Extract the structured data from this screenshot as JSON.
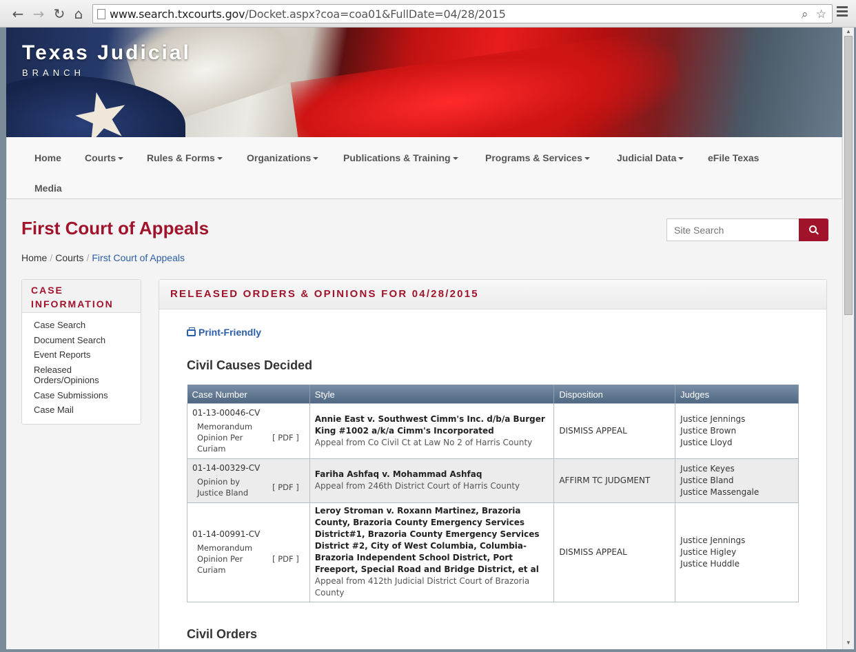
{
  "browser": {
    "url_host": "www.search.txcourts.gov",
    "url_path": "/Docket.aspx?coa=coa01&FullDate=04/28/2015"
  },
  "brand": {
    "title": "Texas Judicial",
    "subtitle": "BRANCH"
  },
  "nav": [
    {
      "label": "Home",
      "dropdown": false
    },
    {
      "label": "Courts",
      "dropdown": true
    },
    {
      "label": "Rules & Forms",
      "dropdown": true
    },
    {
      "label": "Organizations",
      "dropdown": true
    },
    {
      "label": "Publications & Training",
      "dropdown": true
    },
    {
      "label": "Programs & Services",
      "dropdown": true
    },
    {
      "label": "Judicial Data",
      "dropdown": true
    },
    {
      "label": "eFile Texas",
      "dropdown": false
    },
    {
      "label": "Media",
      "dropdown": false
    }
  ],
  "page": {
    "title": "First Court of Appeals",
    "search_placeholder": "Site Search"
  },
  "breadcrumb": [
    "Home",
    "Courts",
    "First Court of Appeals"
  ],
  "sidebar": {
    "heading_line1": "CASE",
    "heading_line2": "INFORMATION",
    "items": [
      "Case Search",
      "Document Search",
      "Event Reports",
      "Released Orders/Opinions",
      "Case Submissions",
      "Case Mail"
    ]
  },
  "panel": {
    "heading": "RELEASED ORDERS & OPINIONS FOR 04/28/2015",
    "print_label": "Print-Friendly",
    "section1": "Civil Causes Decided",
    "section2": "Civil Orders"
  },
  "table": {
    "headers": [
      "Case Number",
      "Style",
      "Disposition",
      "Judges"
    ],
    "rows": [
      {
        "case_number": "01-13-00046-CV",
        "opinion_type": "Memorandum Opinion Per Curiam",
        "pdf": "[ PDF ]",
        "style_title": "Annie East v. Southwest Cimm's Inc. d/b/a Burger King #1002 a/k/a Cimm's Incorporated",
        "style_sub": "Appeal from Co Civil Ct at Law No 2 of Harris County",
        "disposition": "DISMISS APPEAL",
        "judges": [
          "Justice Jennings",
          "Justice Brown",
          "Justice Lloyd"
        ]
      },
      {
        "case_number": "01-14-00329-CV",
        "opinion_type": "Opinion by Justice Bland",
        "pdf": "[ PDF ]",
        "style_title": "Fariha Ashfaq v. Mohammad Ashfaq",
        "style_sub": "Appeal from 246th District Court of Harris County",
        "disposition": "AFFIRM TC JUDGMENT",
        "judges": [
          "Justice Keyes",
          "Justice Bland",
          "Justice Massengale"
        ]
      },
      {
        "case_number": "01-14-00991-CV",
        "opinion_type": "Memorandum Opinion Per Curiam",
        "pdf": "[ PDF ]",
        "style_title": "Leroy Stroman v. Roxann Martinez, Brazoria County, Brazoria County Emergency Services District#1, Brazoria County Emergency Services District #2, City of West Columbia, Columbia-Brazoria Independent School District, Port Freeport, Special Road and Bridge District, et al",
        "style_sub": "Appeal from 412th Judicial District Court of Brazoria County",
        "disposition": "DISMISS APPEAL",
        "judges": [
          "Justice Jennings",
          "Justice Higley",
          "Justice Huddle"
        ]
      }
    ]
  }
}
